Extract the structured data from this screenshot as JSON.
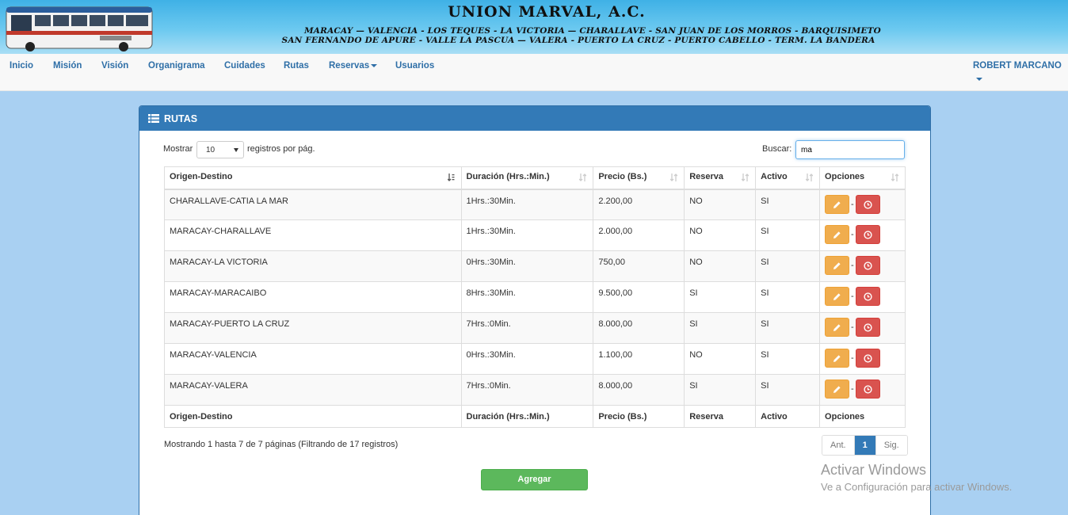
{
  "banner": {
    "title": "UNION MARVAL, A.C.",
    "routes_line1": "MARACAY — VALENCIA - LOS TEQUES - LA VICTORIA — CHARALLAVE - SAN JUAN DE LOS MORROS - BARQUISIMETO",
    "routes_line2": "SAN FERNANDO DE APURE - VALLE  LA PASCUA — VALERA - PUERTO LA CRUZ - PUERTO CABELLO - TERM. LA BANDERA"
  },
  "nav": {
    "items": [
      "Inicio",
      "Misión",
      "Visión",
      "Organigrama",
      "Cuidades",
      "Rutas",
      "Reservas",
      "Usuarios"
    ],
    "user": "ROBERT MARCANO"
  },
  "panel": {
    "title": "RUTAS",
    "show_label": "Mostrar",
    "page_size": "10",
    "records_label": "registros por pág.",
    "search_label": "Buscar:",
    "search_value": "ma"
  },
  "table": {
    "columns": [
      "Origen-Destino",
      "Duración (Hrs.:Min.)",
      "Precio (Bs.)",
      "Reserva",
      "Activo",
      "Opciones"
    ],
    "rows": [
      [
        "CHARALLAVE-CATIA LA MAR",
        "1Hrs.:30Min.",
        "2.200,00",
        "NO",
        "SI"
      ],
      [
        "MARACAY-CHARALLAVE",
        "1Hrs.:30Min.",
        "2.000,00",
        "NO",
        "SI"
      ],
      [
        "MARACAY-LA VICTORIA",
        "0Hrs.:30Min.",
        "750,00",
        "NO",
        "SI"
      ],
      [
        "MARACAY-MARACAIBO",
        "8Hrs.:30Min.",
        "9.500,00",
        "SI",
        "SI"
      ],
      [
        "MARACAY-PUERTO LA CRUZ",
        "7Hrs.:0Min.",
        "8.000,00",
        "SI",
        "SI"
      ],
      [
        "MARACAY-VALENCIA",
        "0Hrs.:30Min.",
        "1.100,00",
        "NO",
        "SI"
      ],
      [
        "MARACAY-VALERA",
        "7Hrs.:0Min.",
        "8.000,00",
        "SI",
        "SI"
      ]
    ],
    "option_separator": "-"
  },
  "footer": {
    "info": "Mostrando 1 hasta 7 de 7 páginas (Filtrando de 17 registros)",
    "prev": "Ant.",
    "page": "1",
    "next": "Sig.",
    "add_button": "Agregar"
  },
  "watermark": {
    "line1": "Activar Windows",
    "line2": "Ve a Configuración para activar Windows."
  },
  "colors": {
    "primary": "#337ab7",
    "warning": "#f0ad4e",
    "danger": "#d9534f",
    "success": "#5cb85c",
    "page_bg": "#a9d0f2"
  }
}
